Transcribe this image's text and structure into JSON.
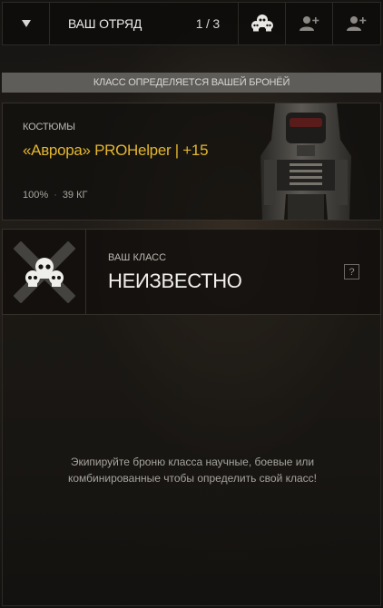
{
  "squad": {
    "title": "ВАШ ОТРЯД",
    "count": "1 / 3",
    "icons": [
      "chevron-down-icon",
      "skull-emblem-icon",
      "add-member-icon",
      "add-member-icon"
    ]
  },
  "banner": "КЛАСС ОПРЕДЕЛЯЕТСЯ ВАШЕЙ БРОНЁЙ",
  "armor": {
    "category": "КОСТЮМЫ",
    "name": "«Аврора» PROHelper | +15",
    "durability": "100%",
    "separator": "·",
    "weight": "39 КГ"
  },
  "class_info": {
    "label": "ВАШ КЛАСС",
    "value": "НЕИЗВЕСТНО",
    "help": "?",
    "icon": "crossed-skulls-icon"
  },
  "hint": "Экипируйте броню класса научные, боевые или комбинированные чтобы определить свой класс!",
  "colors": {
    "accent_gold": "#e3b62e",
    "banner_bg": "#5f5d5a",
    "background": "#1d1a17"
  }
}
